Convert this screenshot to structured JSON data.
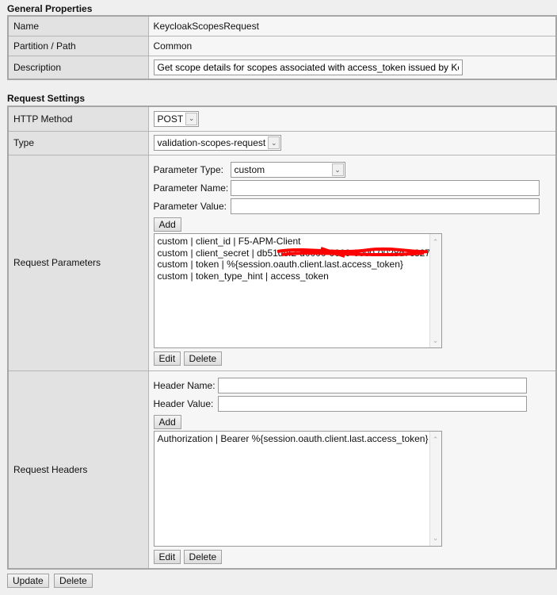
{
  "general": {
    "title": "General Properties",
    "rows": [
      {
        "label": "Name",
        "value": "KeycloakScopesRequest"
      },
      {
        "label": "Partition / Path",
        "value": "Common"
      },
      {
        "label": "Description",
        "value": "Get scope details for scopes associated with access_token issued by Ke"
      }
    ]
  },
  "request": {
    "title": "Request Settings",
    "http_method": {
      "label": "HTTP Method",
      "value": "POST"
    },
    "type": {
      "label": "Type",
      "value": "validation-scopes-request"
    },
    "params": {
      "label": "Request Parameters",
      "type_label": "Parameter Type:",
      "type_value": "custom",
      "name_label": "Parameter Name:",
      "name_value": "",
      "value_label": "Parameter Value:",
      "value_value": "",
      "add": "Add",
      "items": [
        "custom | client_id | F5-APM-Client",
        "custom | client_secret | db51def2-d0000-0000-0000-0028d7c327a",
        "custom | token | %{session.oauth.client.last.access_token}",
        "custom | token_type_hint | access_token"
      ],
      "edit": "Edit",
      "delete": "Delete"
    },
    "headers": {
      "label": "Request Headers",
      "name_label": "Header Name:",
      "name_value": "",
      "value_label": "Header Value:",
      "value_value": "",
      "add": "Add",
      "items": [
        "Authorization | Bearer %{session.oauth.client.last.access_token}"
      ],
      "edit": "Edit",
      "delete": "Delete"
    }
  },
  "footer": {
    "update": "Update",
    "delete": "Delete"
  }
}
